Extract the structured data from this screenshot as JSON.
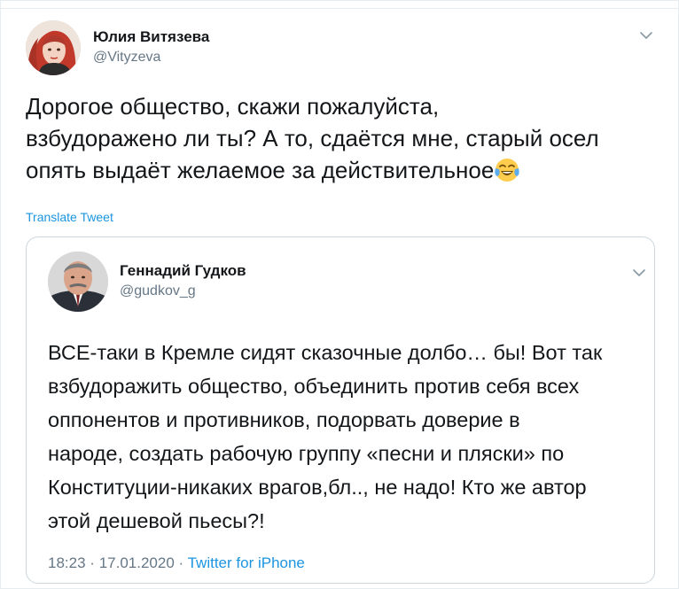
{
  "tweet": {
    "author_name": "Юлия Витязева",
    "author_handle": "@Vityzeva",
    "text": "Дорогое общество, скажи пожалуйста,\nвзбудоражено ли ты? А то, сдаётся мне, старый осел\nопять выдаёт желаемое за действительное",
    "emoji": "face-with-tears-of-joy-icon",
    "translate_label": "Translate Tweet"
  },
  "quoted_tweet": {
    "author_name": "Геннадий Гудков",
    "author_handle": "@gudkov_g",
    "text": "ВСЕ-таки в Кремле сидят сказочные долбо… бы! Вот так\nвзбудоражить общество, объединить против себя всех\nоппонентов и противников, подорвать доверие  в\nнароде, создать рабочую группу «песни и пляски» по\nКонституции-никаких врагов,бл.., не надо! Кто же автор\nэтой дешевой пьесы?!",
    "time": "18:23",
    "date": "17.01.2020",
    "separator": "·",
    "source": "Twitter for iPhone"
  },
  "colors": {
    "text": "#14171a",
    "secondary": "#657786",
    "link": "#1b95e0",
    "border": "#ccd6dd"
  }
}
